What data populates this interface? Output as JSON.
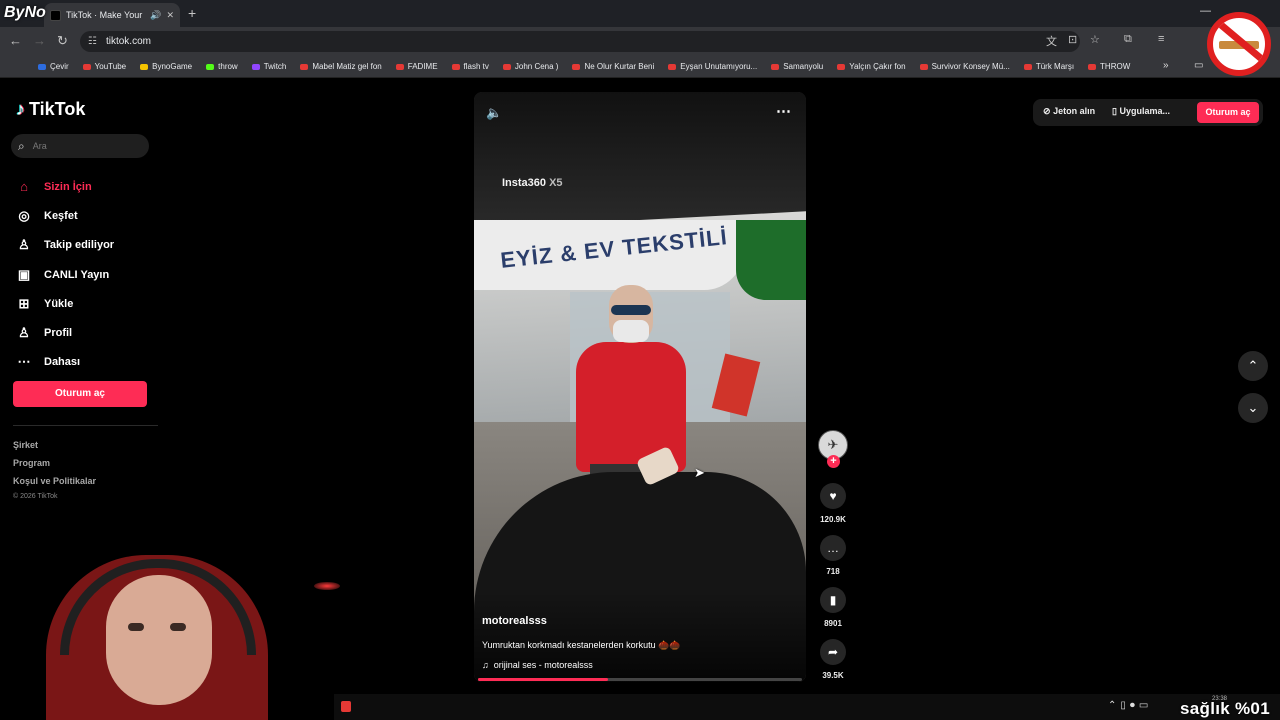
{
  "browser": {
    "tab_title": "Make Your Day",
    "tab_title_prefix": "TikTok",
    "url": "tiktok.com",
    "bookmarks": [
      {
        "label": "Çevir",
        "icon": "translate-icon",
        "color": "#2d6cdf"
      },
      {
        "label": "YouTube",
        "icon": "youtube-icon",
        "color": "#e53935"
      },
      {
        "label": "BynoGame",
        "icon": "bynogame-icon",
        "color": "#f5c400"
      },
      {
        "label": "throw",
        "icon": "kick-icon",
        "color": "#53fc18"
      },
      {
        "label": "Twitch",
        "icon": "twitch-icon",
        "color": "#9146ff"
      },
      {
        "label": "Mabel Matiz gel fon",
        "icon": "youtube-icon",
        "color": "#e53935"
      },
      {
        "label": "FADIME",
        "icon": "youtube-icon",
        "color": "#e53935"
      },
      {
        "label": "flash tv",
        "icon": "youtube-icon",
        "color": "#e53935"
      },
      {
        "label": "John Cena )",
        "icon": "youtube-icon",
        "color": "#e53935"
      },
      {
        "label": "Ne Olur Kurtar Beni",
        "icon": "youtube-icon",
        "color": "#e53935"
      },
      {
        "label": "Eyşan Unutamıyoru...",
        "icon": "youtube-icon",
        "color": "#e53935"
      },
      {
        "label": "Samanyolu",
        "icon": "youtube-icon",
        "color": "#e53935"
      },
      {
        "label": "Yalçın Çakır fon",
        "icon": "youtube-icon",
        "color": "#e53935"
      },
      {
        "label": "Survivor Konsey Mü...",
        "icon": "youtube-icon",
        "color": "#e53935"
      },
      {
        "label": "Türk Marşı",
        "icon": "youtube-icon",
        "color": "#e53935"
      },
      {
        "label": "THROW",
        "icon": "youtube-icon",
        "color": "#e53935"
      }
    ]
  },
  "sidebar": {
    "brand": "TikTok",
    "search_placeholder": "Ara",
    "items": [
      {
        "label": "Sizin İçin",
        "icon": "home-icon",
        "glyph": "⌂"
      },
      {
        "label": "Keşfet",
        "icon": "compass-icon",
        "glyph": "◎"
      },
      {
        "label": "Takip ediliyor",
        "icon": "following-icon",
        "glyph": "♙"
      },
      {
        "label": "CANLI Yayın",
        "icon": "live-icon",
        "glyph": "▣"
      },
      {
        "label": "Yükle",
        "icon": "upload-icon",
        "glyph": "⊞"
      },
      {
        "label": "Profil",
        "icon": "profile-icon",
        "glyph": "♙"
      },
      {
        "label": "Dahası",
        "icon": "more-icon",
        "glyph": "⋯"
      }
    ],
    "login_label": "Oturum aç",
    "footer": [
      "Şirket",
      "Program",
      "Koşul ve Politikalar"
    ],
    "copyright": "© 2026 TikTok"
  },
  "header": {
    "coins_label": "Jeton alın",
    "app_label": "Uygulama...",
    "login_label": "Oturum aç"
  },
  "video": {
    "watermark": "Insta360",
    "watermark_model": "X5",
    "sign_text": "EYİZ & EV TEKSTİLİ",
    "author": "motorealsss",
    "description": "Yumruktan korkmadı kestanelerden korkutu 🌰🌰",
    "sound": "orijinal ses - motorealsss",
    "progress": 0.4
  },
  "actions": {
    "likes": "120.9K",
    "comments": "718",
    "saves": "8901",
    "shares": "39.5K"
  },
  "overlay": {
    "channel": "ByNo",
    "ticker": "sağlık %01",
    "clock": "23:38"
  },
  "colors": {
    "accent": "#fe2c55",
    "background": "#000000"
  }
}
